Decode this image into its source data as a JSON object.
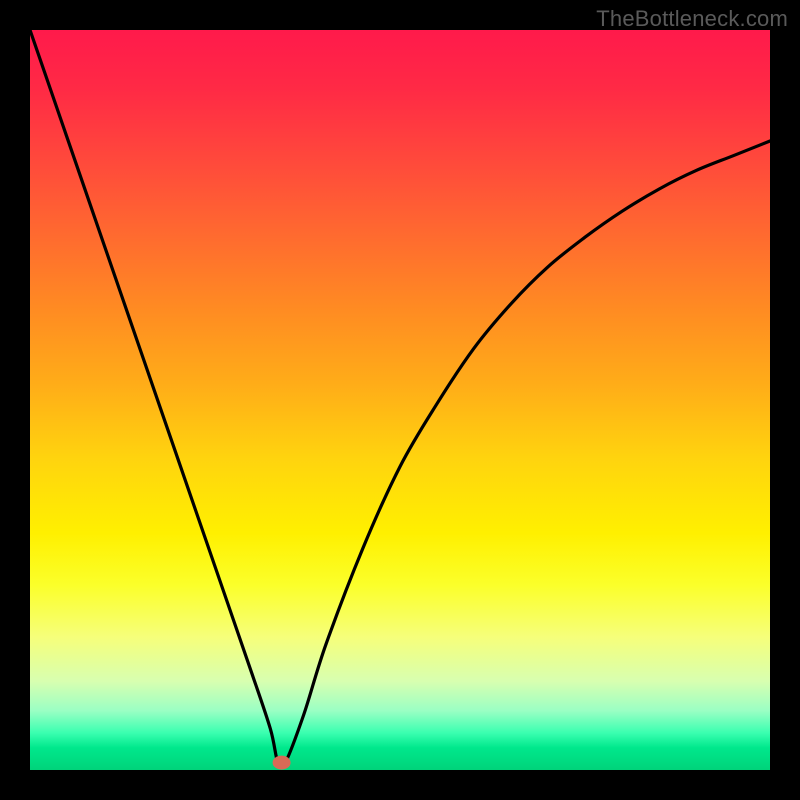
{
  "watermark": {
    "text": "TheBottleneck.com"
  },
  "chart_data": {
    "type": "line",
    "title": "",
    "xlabel": "",
    "ylabel": "",
    "xlim": [
      0,
      100
    ],
    "ylim": [
      0,
      100
    ],
    "series": [
      {
        "name": "curve",
        "x": [
          0,
          5,
          10,
          15,
          20,
          25,
          30,
          32.5,
          33.5,
          34.5,
          37,
          40,
          45,
          50,
          55,
          60,
          65,
          70,
          75,
          80,
          85,
          90,
          95,
          100
        ],
        "y": [
          100,
          85.5,
          71,
          56.5,
          42,
          27.5,
          13,
          5.5,
          1,
          1,
          7.5,
          17,
          30,
          41,
          49.5,
          57,
          63,
          68,
          72,
          75.5,
          78.5,
          81,
          83,
          85
        ]
      }
    ],
    "marker": {
      "x": 34,
      "y": 1,
      "color": "#d86a56"
    },
    "gradient_stops": [
      {
        "pos": 0,
        "color": "#ff1a4b"
      },
      {
        "pos": 50,
        "color": "#ffc400"
      },
      {
        "pos": 80,
        "color": "#fff000"
      },
      {
        "pos": 100,
        "color": "#00d37a"
      }
    ]
  }
}
